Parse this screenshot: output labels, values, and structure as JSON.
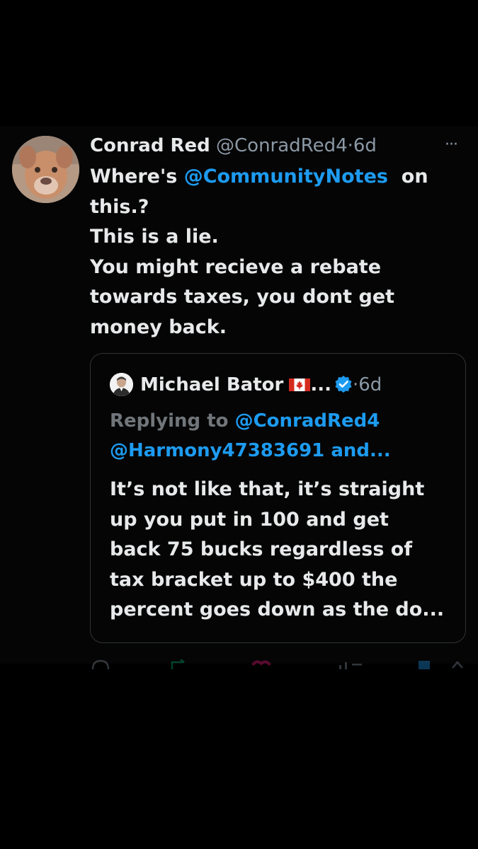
{
  "tweet": {
    "display_name": "Conrad Red",
    "handle": "@ConradRed4",
    "separator": "·",
    "time": "6d",
    "more": "···",
    "text": {
      "line1_prefix": "Where's ",
      "line1_mention": "@CommunityNotes",
      "line1_suffix": "  on",
      "line2": "this.?",
      "line3": "This is a lie.",
      "line4": "You might recieve a rebate",
      "line5": "towards taxes, you dont get",
      "line6": "money back."
    }
  },
  "quote": {
    "display_name": "Michael Bator",
    "name_suffix": "...",
    "separator": "·",
    "time": "6d",
    "replying_prefix": "Replying to ",
    "replying_mention1": "@ConradRed4",
    "replying_mention2": "@Harmony47383691 and...",
    "text": [
      "It’s not like that, it’s straight",
      "up you put in 100 and get",
      "back 75 bucks regardless of",
      "tax bracket up to $400 the",
      "percent goes down as the do..."
    ]
  },
  "colors": {
    "background": "#000000",
    "text": "#e7e9ea",
    "secondary": "#8b98a5",
    "link": "#1d9bf0",
    "border": "#2f3336"
  },
  "icons": {
    "avatar": "dog-photo",
    "quote_avatar": "person-photo",
    "flag": "canada-flag-icon",
    "verified": "verified-badge-icon",
    "more": "more-options-icon"
  }
}
